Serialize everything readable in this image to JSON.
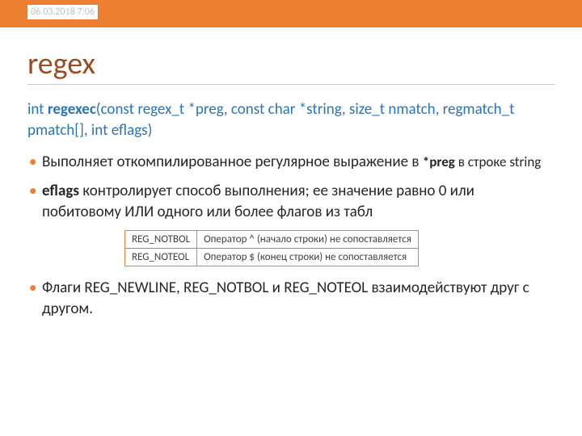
{
  "timestamp": "06.03.2018 7:06",
  "title": "regex",
  "signature": {
    "ret": "int ",
    "fn": "regexec",
    "args": "(const regex_t *preg, const char *string, size_t nmatch, regmatch_t pmatch[], int eflags)"
  },
  "bullets": {
    "b1_a": "Выполняет откомпилированное регулярное выражение в ",
    "b1_b": "*preg",
    "b1_c": " в строке string",
    "b2_a": "eflags",
    "b2_b": " контролирует способ выполнения; ее значение равно 0 или побитовому ИЛИ одного или более флагов из табл",
    "b3": "Флаги REG_NEWLINE, REG_NOTBOL и REG_NOTEOL взаимодействуют друг с другом."
  },
  "table": {
    "r1c1": "REG_NOTBOL",
    "r1c2": "Оператор ^ (начало строки) не сопоставляется",
    "r2c1": "REG_NOTEOL",
    "r2c2": "Оператор $ (конец строки) не сопоставляется"
  }
}
